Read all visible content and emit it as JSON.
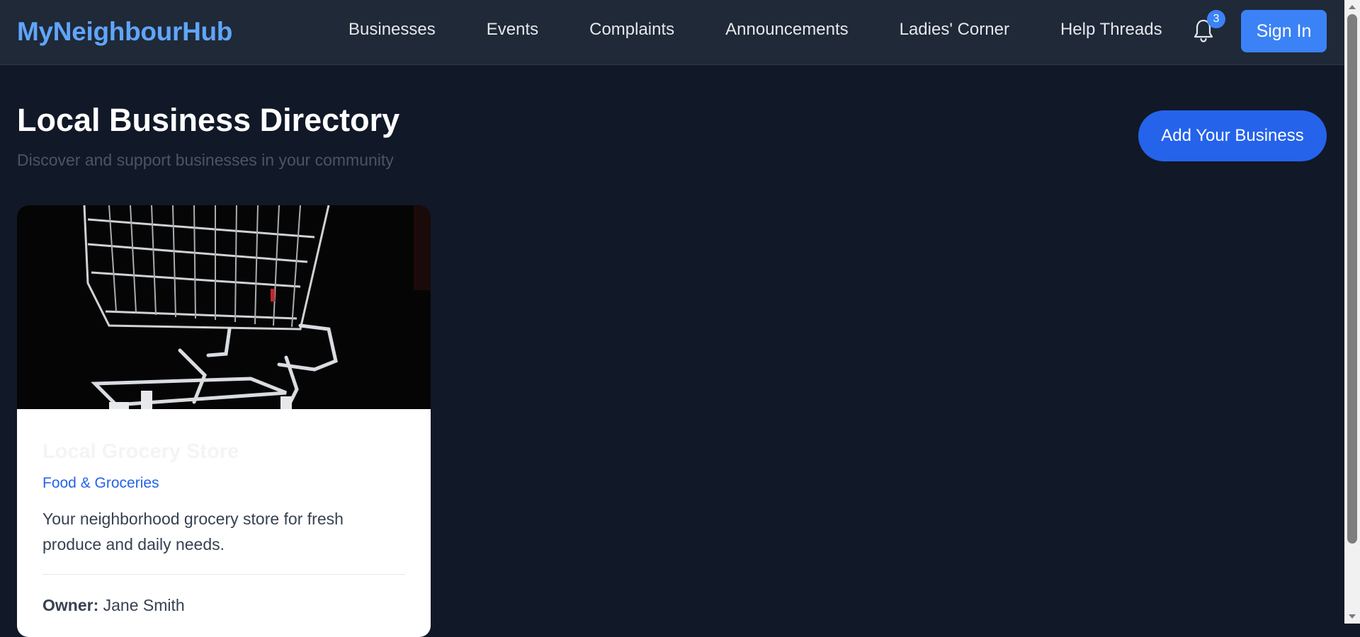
{
  "navbar": {
    "brand": "MyNeighbourHub",
    "links": [
      "Businesses",
      "Events",
      "Complaints",
      "Announcements",
      "Ladies' Corner",
      "Help Threads"
    ],
    "notification_count": "3",
    "signin_label": "Sign In"
  },
  "header": {
    "title": "Local Business Directory",
    "subtitle": "Discover and support businesses in your community",
    "add_button_label": "Add Your Business"
  },
  "businesses": [
    {
      "name": "Local Grocery Store",
      "category": "Food & Groceries",
      "description": "Your neighborhood grocery store for fresh produce and daily needs.",
      "owner_label": "Owner:",
      "owner": "Jane Smith",
      "image_icon": "shopping-cart-photo"
    }
  ],
  "colors": {
    "background": "#111827",
    "navbar": "#1f2937",
    "brand": "#60a5fa",
    "accent": "#2563eb",
    "badge": "#3b82f6"
  }
}
